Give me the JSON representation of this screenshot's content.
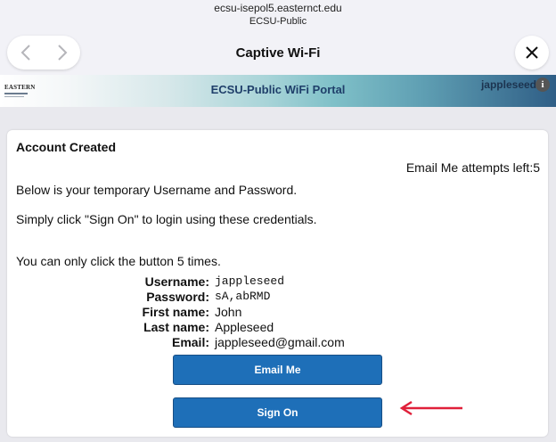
{
  "browser": {
    "host": "ecsu-isepol5.easternct.edu",
    "network": "ECSU-Public",
    "title": "Captive Wi-Fi"
  },
  "banner": {
    "logo_text": "EASTERN",
    "title": "ECSU-Public WiFi Portal",
    "user": "jappleseed"
  },
  "card": {
    "heading": "Account Created",
    "attempts": "Email Me attempts left:5",
    "line1": "Below is your temporary Username and Password.",
    "line2": "Simply click \"Sign On\" to login using these credentials.",
    "line3": "You can only click the button 5 times.",
    "fields": [
      {
        "label": "Username:",
        "value": "jappleseed"
      },
      {
        "label": "Password:",
        "value": "sA,abRMD"
      },
      {
        "label": "First name:",
        "value": "John"
      },
      {
        "label": "Last name:",
        "value": "Appleseed"
      },
      {
        "label": "Email:",
        "value": "jappleseed@gmail.com"
      }
    ],
    "email_button": "Email Me",
    "signon_button": "Sign On"
  },
  "colors": {
    "button": "#1e6fb8",
    "arrow": "#e0203a",
    "portal_title": "#1f3f6a"
  },
  "icons": [
    "chevron-left-icon",
    "chevron-right-icon",
    "close-icon",
    "info-icon",
    "arrow-left-icon"
  ]
}
